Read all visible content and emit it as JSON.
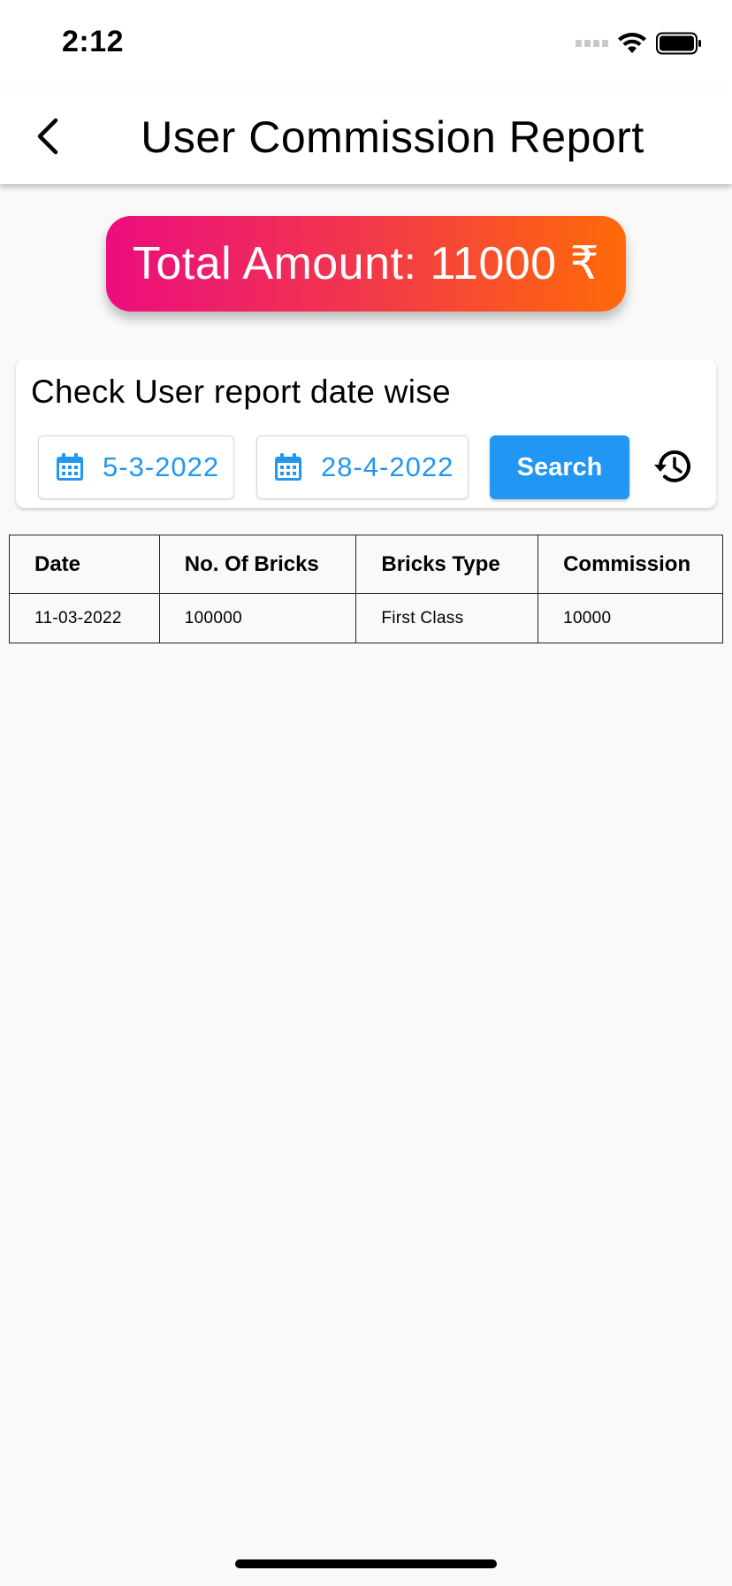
{
  "status_bar": {
    "time": "2:12"
  },
  "app_bar": {
    "title": "User Commission Report"
  },
  "summary": {
    "total_label": "Total Amount: 11000 ₹"
  },
  "filter": {
    "heading": "Check User report date wise",
    "from_date": "5-3-2022",
    "to_date": "28-4-2022",
    "search_label": "Search"
  },
  "table": {
    "headers": [
      "Date",
      "No. Of Bricks",
      "Bricks Type",
      "Commission"
    ],
    "rows": [
      [
        "11-03-2022",
        "100000",
        "First Class",
        "10000"
      ]
    ]
  },
  "colors": {
    "accent": "#2196f3",
    "badge_gradient_start": "#ec0d7e",
    "badge_gradient_end": "#ff6a08"
  },
  "icons": [
    "back-arrow-icon",
    "calendar-icon",
    "history-icon",
    "wifi-icon",
    "battery-icon",
    "signal-icon"
  ]
}
